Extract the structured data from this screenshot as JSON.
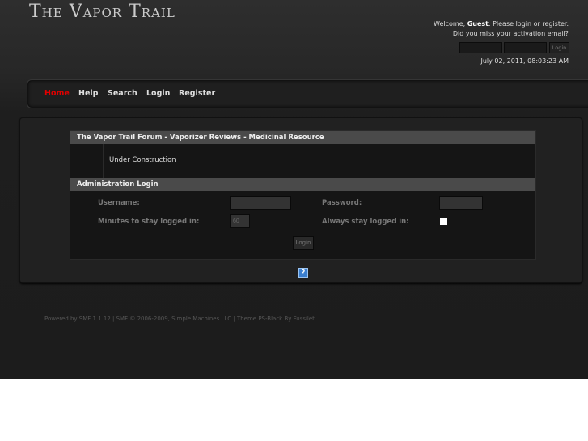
{
  "header": {
    "logo_text": "The Vapor Trail",
    "welcome_prefix": "Welcome, ",
    "user": "Guest",
    "welcome_suffix": ". Please login or register.",
    "activation": "Did you miss your activation email?",
    "login_button": "Login",
    "date": "July 02, 2011, 08:03:23 AM"
  },
  "nav": {
    "items": [
      "Home",
      "Help",
      "Search",
      "Login",
      "Register"
    ],
    "active_color": "#e00000"
  },
  "board": {
    "title": "The Vapor Trail Forum - Vaporizer Reviews - Medicinal Resource",
    "message": "Under Construction"
  },
  "login": {
    "title": "Administration Login",
    "username_label": "Username:",
    "password_label": "Password:",
    "minutes_label": "Minutes to stay logged in:",
    "minutes_value": "60",
    "always_label": "Always stay logged in:",
    "button": "Login"
  },
  "help_icon": "?",
  "footer": {
    "text": "Powered by SMF 1.1.12 | SMF © 2006-2009, Simple Machines LLC | Theme PS-Black By Fussilet"
  }
}
